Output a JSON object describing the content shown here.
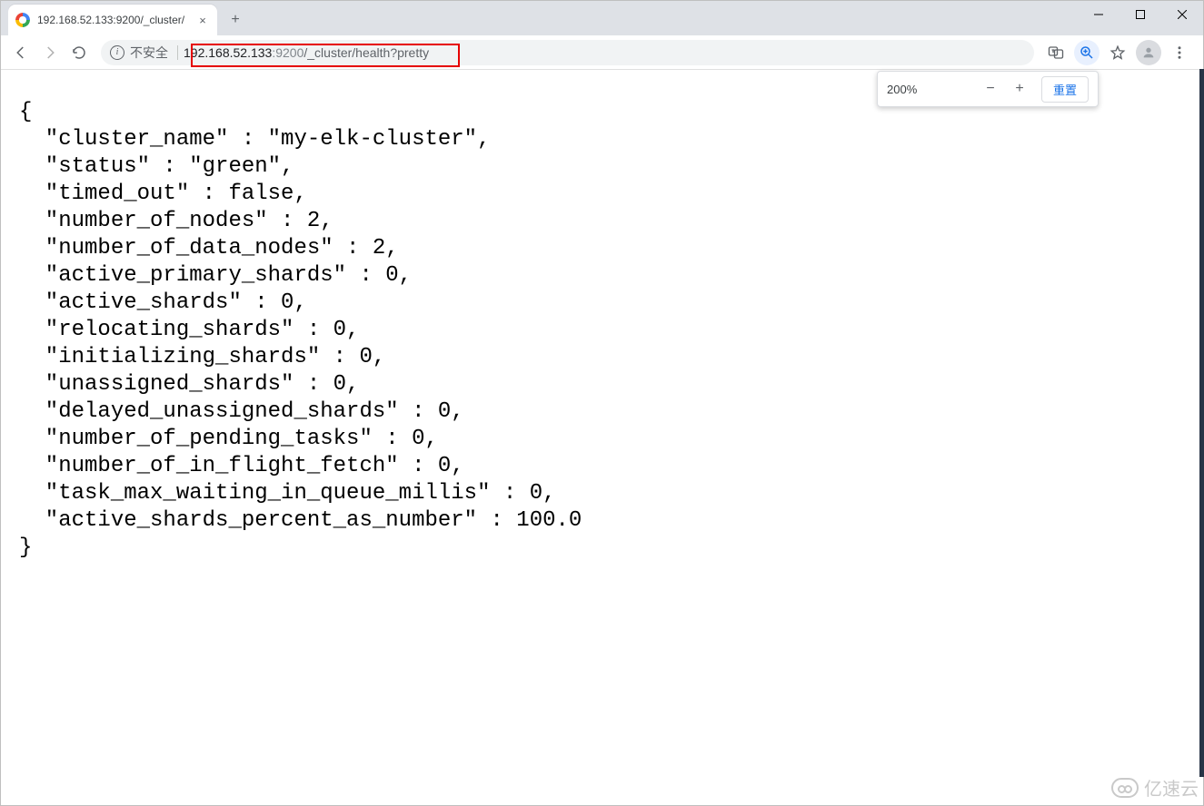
{
  "window": {
    "minimize_tip": "Minimize",
    "maximize_tip": "Maximize",
    "close_tip": "Close"
  },
  "tab": {
    "title": "192.168.52.133:9200/_cluster/",
    "close_tip": "×"
  },
  "newtab_glyph": "+",
  "toolbar": {
    "back_tip": "Back",
    "forward_tip": "Forward",
    "reload_tip": "Reload",
    "insecure_label": "不安全",
    "url_host": "192.168.52.133",
    "url_port": ":9200",
    "url_path": "/_cluster/health?pretty",
    "translate_tip": "Translate",
    "zoom_tip": "Zoom",
    "star_tip": "Bookmark",
    "profile_tip": "Profile",
    "menu_tip": "Menu"
  },
  "zoom_popup": {
    "value": "200%",
    "minus": "−",
    "plus": "+",
    "reset": "重置"
  },
  "json_text": "{\n  \"cluster_name\" : \"my-elk-cluster\",\n  \"status\" : \"green\",\n  \"timed_out\" : false,\n  \"number_of_nodes\" : 2,\n  \"number_of_data_nodes\" : 2,\n  \"active_primary_shards\" : 0,\n  \"active_shards\" : 0,\n  \"relocating_shards\" : 0,\n  \"initializing_shards\" : 0,\n  \"unassigned_shards\" : 0,\n  \"delayed_unassigned_shards\" : 0,\n  \"number_of_pending_tasks\" : 0,\n  \"number_of_in_flight_fetch\" : 0,\n  \"task_max_waiting_in_queue_millis\" : 0,\n  \"active_shards_percent_as_number\" : 100.0\n}",
  "watermark": {
    "text": "亿速云"
  }
}
